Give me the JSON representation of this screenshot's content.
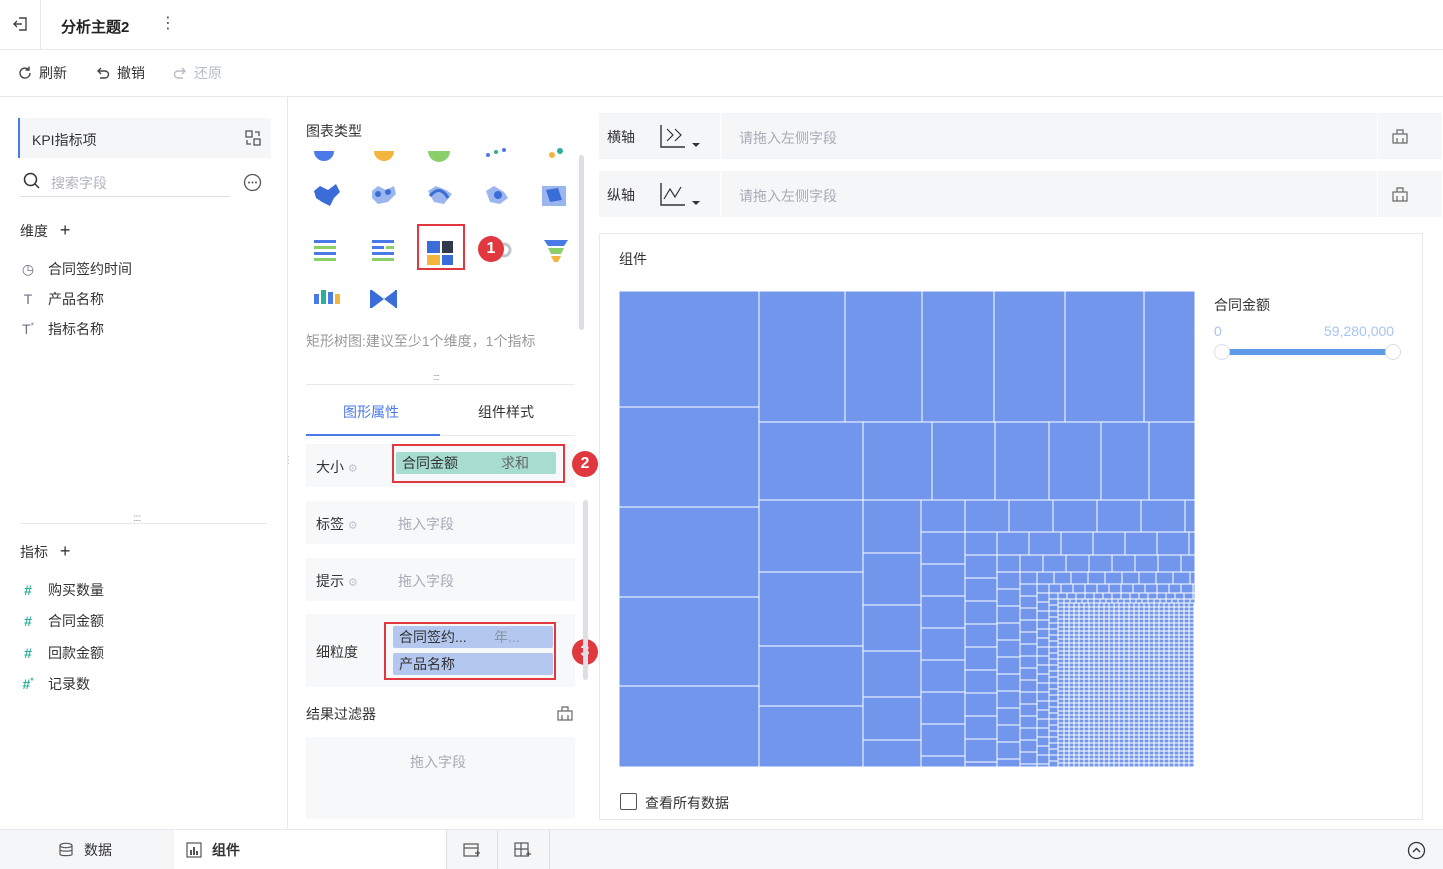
{
  "header": {
    "title": "分析主题2",
    "more_icon": "more-vertical-icon",
    "back_icon": "exit-icon"
  },
  "toolbar": {
    "refresh_label": "刷新",
    "undo_label": "撤销",
    "redo_label": "还原"
  },
  "left_pane": {
    "kpi_title": "KPI指标项",
    "search_placeholder": "搜索字段",
    "dimension_title": "维度",
    "dimensions": [
      {
        "label": "合同签约时间",
        "icon": "clock-icon"
      },
      {
        "label": "产品名称",
        "icon": "text-icon"
      },
      {
        "label": "指标名称",
        "icon": "text-calc-icon"
      }
    ],
    "metric_title": "指标",
    "metrics": [
      {
        "label": "购买数量",
        "icon": "hash-icon"
      },
      {
        "label": "合同金额",
        "icon": "hash-icon"
      },
      {
        "label": "回款金额",
        "icon": "hash-icon"
      },
      {
        "label": "记录数",
        "icon": "hash-calc-icon"
      }
    ]
  },
  "middle_pane": {
    "chart_type_title": "图表类型",
    "chart_type_hint": "矩形树图:建议至少1个维度，1个指标",
    "tabs": [
      "图形属性",
      "组件样式"
    ],
    "size_label": "大小",
    "size_field": "合同金额",
    "size_agg": "求和",
    "label_label": "标签",
    "label_hint": "拖入字段",
    "tip_label": "提示",
    "tip_hint": "拖入字段",
    "granularity_label": "细粒度",
    "granularity_field1": "合同签约...",
    "granularity_field1_suffix": "年...",
    "granularity_field2": "产品名称",
    "result_filter_title": "结果过滤器",
    "result_filter_hint": "拖入字段",
    "annotations": [
      "1",
      "2",
      "3"
    ]
  },
  "axes": {
    "x_label": "横轴",
    "y_label": "纵轴",
    "x_placeholder": "请拖入左侧字段",
    "y_placeholder": "请拖入左侧字段"
  },
  "chart_card": {
    "title": "组件",
    "legend_title": "合同金额",
    "legend_min": "0",
    "legend_max": "59,280,000",
    "view_all_label": "查看所有数据",
    "fill_color": "#7196ec",
    "border_color": "#ffffff"
  },
  "bottom_tabs": {
    "data_label": "数据",
    "component_label": "组件"
  },
  "chart_data": {
    "type": "treemap",
    "title": "",
    "size_measure": "合同金额",
    "color_range": [
      0,
      59280000
    ]
  }
}
